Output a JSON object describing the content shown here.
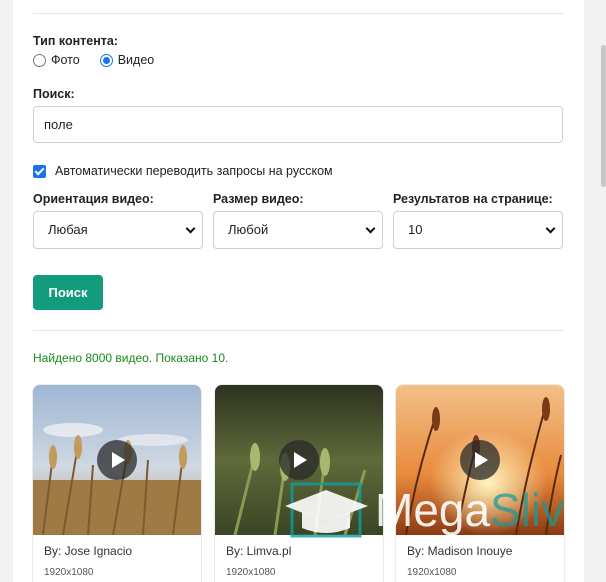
{
  "content_type": {
    "label": "Тип контента:",
    "options": [
      {
        "label": "Фото",
        "selected": false
      },
      {
        "label": "Видео",
        "selected": true
      }
    ]
  },
  "search": {
    "label": "Поиск:",
    "value": "поле"
  },
  "auto_translate": {
    "label": "Автоматически переводить запросы на русском",
    "checked": true
  },
  "filters": {
    "orientation": {
      "label": "Ориентация видео:",
      "value": "Любая"
    },
    "size": {
      "label": "Размер видео:",
      "value": "Любой"
    },
    "per_page": {
      "label": "Результатов на странице:",
      "value": "10"
    }
  },
  "search_button": "Поиск",
  "results_text": "Найдено 8000 видео. Показано 10.",
  "videos": [
    {
      "author": "By: Jose Ignacio",
      "resolution": "1920x1080"
    },
    {
      "author": "By: Limva.pl",
      "resolution": "1920x1080"
    },
    {
      "author": "By: Madison Inouye",
      "resolution": "1920x1080"
    }
  ],
  "watermark": "MegaSliv",
  "colors": {
    "accent_blue": "#1a73e8",
    "button_green": "#129c7d",
    "result_green": "#1a8a1a"
  }
}
